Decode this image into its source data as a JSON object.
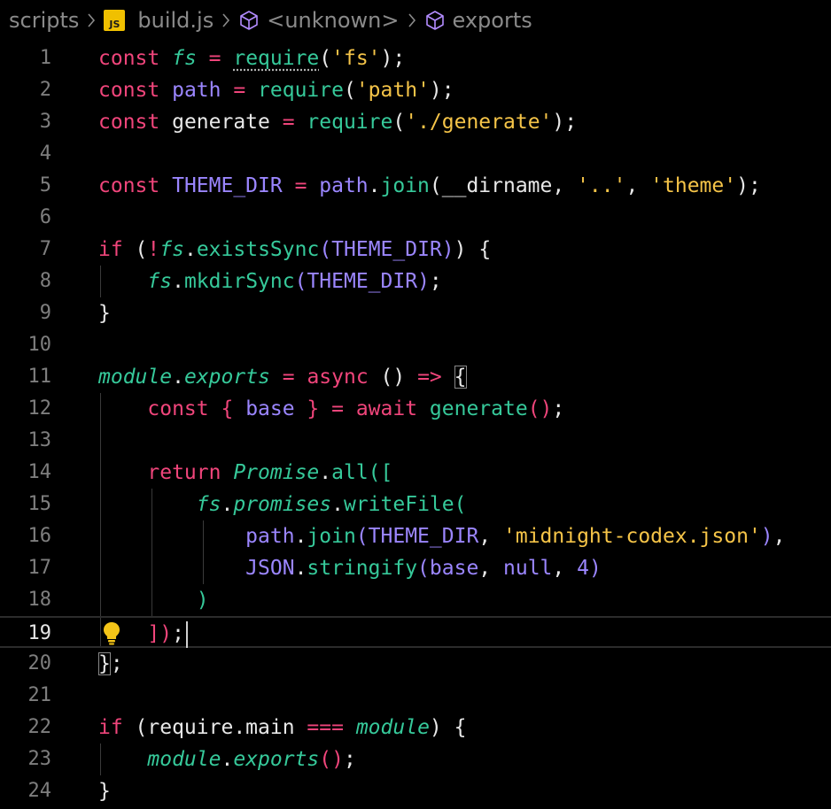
{
  "breadcrumb": {
    "folder": "scripts",
    "file_icon_label": "JS",
    "file": "build.js",
    "symbol1": "<unknown>",
    "symbol2": "exports"
  },
  "colors": {
    "background": "#000000",
    "keyword": "#f0457b",
    "function": "#36c99a",
    "string": "#f5c448",
    "variable": "#9b86ff",
    "line_number": "#7e7e7e"
  },
  "editor": {
    "current_line": 19,
    "lines": [
      {
        "n": "1",
        "tokens": [
          {
            "t": "const ",
            "c": "kw"
          },
          {
            "t": "fs",
            "c": "it"
          },
          {
            "t": " = ",
            "c": "kw"
          },
          {
            "t": "require",
            "c": "fn"
          },
          {
            "t": "(",
            "c": "pl"
          },
          {
            "t": "'fs'",
            "c": "str"
          },
          {
            "t": ");",
            "c": "pl"
          }
        ]
      },
      {
        "n": "2",
        "tokens": [
          {
            "t": "const ",
            "c": "kw"
          },
          {
            "t": "path",
            "c": "var"
          },
          {
            "t": " = ",
            "c": "kw"
          },
          {
            "t": "require",
            "c": "fn"
          },
          {
            "t": "(",
            "c": "pl"
          },
          {
            "t": "'path'",
            "c": "str"
          },
          {
            "t": ");",
            "c": "pl"
          }
        ]
      },
      {
        "n": "3",
        "tokens": [
          {
            "t": "const ",
            "c": "kw"
          },
          {
            "t": "generate",
            "c": "pl"
          },
          {
            "t": " = ",
            "c": "kw"
          },
          {
            "t": "require",
            "c": "fn"
          },
          {
            "t": "(",
            "c": "pl"
          },
          {
            "t": "'./generate'",
            "c": "str"
          },
          {
            "t": ");",
            "c": "pl"
          }
        ]
      },
      {
        "n": "4",
        "tokens": []
      },
      {
        "n": "5",
        "tokens": [
          {
            "t": "const ",
            "c": "kw"
          },
          {
            "t": "THEME_DIR",
            "c": "var"
          },
          {
            "t": " = ",
            "c": "kw"
          },
          {
            "t": "path",
            "c": "var"
          },
          {
            "t": ".",
            "c": "pl"
          },
          {
            "t": "join",
            "c": "fn"
          },
          {
            "t": "(__dirname, ",
            "c": "pl"
          },
          {
            "t": "'..'",
            "c": "str"
          },
          {
            "t": ", ",
            "c": "pl"
          },
          {
            "t": "'theme'",
            "c": "str"
          },
          {
            "t": ");",
            "c": "pl"
          }
        ]
      },
      {
        "n": "6",
        "tokens": []
      },
      {
        "n": "7",
        "tokens": [
          {
            "t": "if ",
            "c": "kw"
          },
          {
            "t": "(",
            "c": "pl"
          },
          {
            "t": "!",
            "c": "kw"
          },
          {
            "t": "fs",
            "c": "it"
          },
          {
            "t": ".",
            "c": "pl"
          },
          {
            "t": "existsSync",
            "c": "fn"
          },
          {
            "t": "(",
            "c": "br1"
          },
          {
            "t": "THEME_DIR",
            "c": "var"
          },
          {
            "t": ")",
            "c": "br1"
          },
          {
            "t": ") {",
            "c": "pl"
          }
        ]
      },
      {
        "n": "8",
        "tokens": [
          {
            "t": "    ",
            "c": "pl"
          },
          {
            "t": "fs",
            "c": "it"
          },
          {
            "t": ".",
            "c": "pl"
          },
          {
            "t": "mkdirSync",
            "c": "fn"
          },
          {
            "t": "(",
            "c": "br1"
          },
          {
            "t": "THEME_DIR",
            "c": "var"
          },
          {
            "t": ")",
            "c": "br1"
          },
          {
            "t": ";",
            "c": "pl"
          }
        ]
      },
      {
        "n": "9",
        "tokens": [
          {
            "t": "}",
            "c": "pl"
          }
        ]
      },
      {
        "n": "10",
        "tokens": []
      },
      {
        "n": "11",
        "tokens": [
          {
            "t": "module",
            "c": "it"
          },
          {
            "t": ".",
            "c": "pl"
          },
          {
            "t": "exports",
            "c": "it"
          },
          {
            "t": " = ",
            "c": "kw"
          },
          {
            "t": "async",
            "c": "kw"
          },
          {
            "t": " () ",
            "c": "pl"
          },
          {
            "t": "=>",
            "c": "kw"
          },
          {
            "t": " ",
            "c": "pl"
          },
          {
            "t": "{",
            "c": "pl",
            "box": true
          }
        ]
      },
      {
        "n": "12",
        "tokens": [
          {
            "t": "    ",
            "c": "pl"
          },
          {
            "t": "const ",
            "c": "kw"
          },
          {
            "t": "{ ",
            "c": "kw"
          },
          {
            "t": "base",
            "c": "var"
          },
          {
            "t": " } = ",
            "c": "kw"
          },
          {
            "t": "await ",
            "c": "kw"
          },
          {
            "t": "generate",
            "c": "fn"
          },
          {
            "t": "()",
            "c": "kw"
          },
          {
            "t": ";",
            "c": "pl"
          }
        ]
      },
      {
        "n": "13",
        "tokens": []
      },
      {
        "n": "14",
        "tokens": [
          {
            "t": "    ",
            "c": "pl"
          },
          {
            "t": "return ",
            "c": "kw"
          },
          {
            "t": "Promise",
            "c": "it"
          },
          {
            "t": ".",
            "c": "pl"
          },
          {
            "t": "all",
            "c": "fn"
          },
          {
            "t": "([",
            "c": "fn"
          }
        ]
      },
      {
        "n": "15",
        "tokens": [
          {
            "t": "        ",
            "c": "pl"
          },
          {
            "t": "fs",
            "c": "it"
          },
          {
            "t": ".",
            "c": "pl"
          },
          {
            "t": "promises",
            "c": "it"
          },
          {
            "t": ".",
            "c": "pl"
          },
          {
            "t": "writeFile",
            "c": "fn"
          },
          {
            "t": "(",
            "c": "fn"
          }
        ]
      },
      {
        "n": "16",
        "tokens": [
          {
            "t": "            ",
            "c": "pl"
          },
          {
            "t": "path",
            "c": "var"
          },
          {
            "t": ".",
            "c": "pl"
          },
          {
            "t": "join",
            "c": "fn"
          },
          {
            "t": "(",
            "c": "br1"
          },
          {
            "t": "THEME_DIR",
            "c": "var"
          },
          {
            "t": ", ",
            "c": "pl"
          },
          {
            "t": "'midnight-codex.json'",
            "c": "str"
          },
          {
            "t": ")",
            "c": "br1"
          },
          {
            "t": ",",
            "c": "pl"
          }
        ]
      },
      {
        "n": "17",
        "tokens": [
          {
            "t": "            ",
            "c": "pl"
          },
          {
            "t": "JSON",
            "c": "var"
          },
          {
            "t": ".",
            "c": "pl"
          },
          {
            "t": "stringify",
            "c": "fn"
          },
          {
            "t": "(",
            "c": "br1"
          },
          {
            "t": "base",
            "c": "var"
          },
          {
            "t": ", ",
            "c": "pl"
          },
          {
            "t": "null",
            "c": "var"
          },
          {
            "t": ", ",
            "c": "pl"
          },
          {
            "t": "4",
            "c": "num"
          },
          {
            "t": ")",
            "c": "br1"
          }
        ]
      },
      {
        "n": "18",
        "tokens": [
          {
            "t": "        ",
            "c": "pl"
          },
          {
            "t": ")",
            "c": "fn"
          }
        ]
      },
      {
        "n": "19",
        "tokens": [
          {
            "t": "    ",
            "c": "pl"
          },
          {
            "t": "])",
            "c": "kw"
          },
          {
            "t": ";",
            "c": "pl"
          }
        ]
      },
      {
        "n": "20",
        "tokens": [
          {
            "t": "}",
            "c": "pl",
            "box": true
          },
          {
            "t": ";",
            "c": "pl"
          }
        ]
      },
      {
        "n": "21",
        "tokens": []
      },
      {
        "n": "22",
        "tokens": [
          {
            "t": "if ",
            "c": "kw"
          },
          {
            "t": "(require.main ",
            "c": "pl"
          },
          {
            "t": "===",
            "c": "kw"
          },
          {
            "t": " ",
            "c": "pl"
          },
          {
            "t": "module",
            "c": "it"
          },
          {
            "t": ") {",
            "c": "pl"
          }
        ]
      },
      {
        "n": "23",
        "tokens": [
          {
            "t": "    ",
            "c": "pl"
          },
          {
            "t": "module",
            "c": "it"
          },
          {
            "t": ".",
            "c": "pl"
          },
          {
            "t": "exports",
            "c": "it"
          },
          {
            "t": "()",
            "c": "kw"
          },
          {
            "t": ";",
            "c": "pl"
          }
        ]
      },
      {
        "n": "24",
        "tokens": [
          {
            "t": "}",
            "c": "pl"
          }
        ]
      }
    ]
  }
}
